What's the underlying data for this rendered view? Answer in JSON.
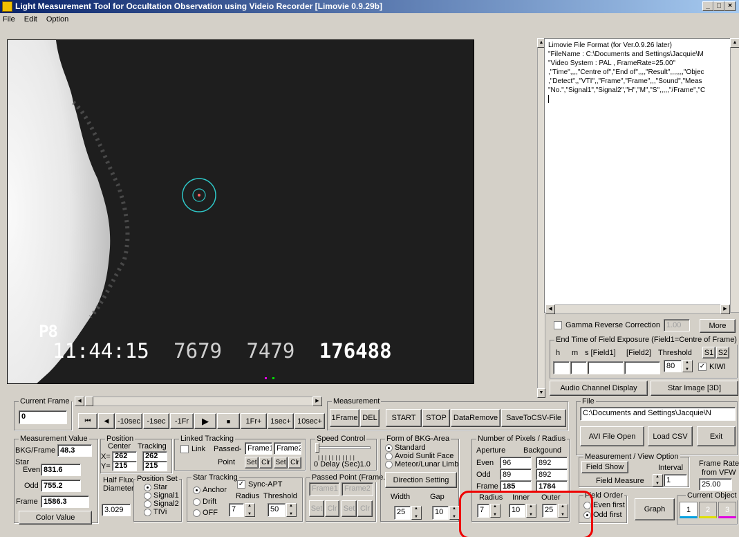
{
  "window": {
    "title": "Light Measurement Tool for Occultation Observation using Videio Recorder [Limovie 0.9.29b]"
  },
  "menu": [
    "File",
    "Edit",
    "Option"
  ],
  "video": {
    "overlay_label": "P8",
    "timestamp": "11:44:15",
    "counter1": "7679",
    "counter2": "7479",
    "counter3": "176488"
  },
  "log": {
    "lines": [
      "Limovie File Format (for Ver.0.9.26 later)",
      "\"FileName : C:\\Documents and Settings\\Jacquie\\M",
      "\"Video System : PAL , FrameRate=25.00\"",
      ",\"Time\",,,,\"Centre of\",\"End of\",,,,\"Result\",,,,,,,\"Objec",
      ",\"Detect\",,\"VTI\",,\"Frame\",\"Frame\",,,\"Sound\",\"Meas",
      "\"No.\",\"Signal1\",\"Signal2\",\"H\",\"M\",\"S\",,,,,\"/Frame\",\"C"
    ]
  },
  "gamma": {
    "label": "Gamma Reverse Correction",
    "value": "1.00",
    "more": "More"
  },
  "field_exposure": {
    "legend": "End Time of Field Exposure (Field1=Centre of Frame)",
    "h": "h",
    "m": "m",
    "s": "s [Field1]",
    "field2": "[Field2]",
    "threshold_label": "Threshold",
    "threshold": "80",
    "s1": "S1",
    "s2": "S2",
    "kiwi": "KIWI"
  },
  "audio_btn": "Audio Channel Display",
  "star_btn": "Star Image [3D]",
  "current_frame": {
    "legend": "Current Frame",
    "value": "0"
  },
  "playback": [
    "⏮",
    "◀",
    "-10sec",
    "-1sec",
    "-1Fr",
    "▶",
    "■",
    "1Fr+",
    "1sec+",
    "10sec+"
  ],
  "measurement": {
    "legend": "Measurement",
    "buttons": [
      "1Frame",
      "DEL",
      "START",
      "STOP",
      "DataRemove",
      "SaveToCSV-File"
    ]
  },
  "file": {
    "legend": "File",
    "path": "C:\\Documents and Settings\\Jacquie\\N",
    "avi": "AVI File Open",
    "csv": "Load CSV",
    "exit": "Exit"
  },
  "mvalue": {
    "legend": "Measurement Value",
    "bkg_label": "BKG/Frame",
    "bkg": "48.3",
    "star": "Star",
    "even_label": "Even",
    "even": "831.6",
    "odd_label": "Odd",
    "odd": "755.2",
    "frame_label": "Frame",
    "frame": "1586.3",
    "color_btn": "Color Value"
  },
  "position": {
    "legend": "Position",
    "center": "Center",
    "tracking": "Tracking",
    "x_label": "X=",
    "y_label": "Y=",
    "cx": "262",
    "cy": "215",
    "tx": "262",
    "ty": "215"
  },
  "linked": {
    "legend": "Linked Tracking",
    "link": "Link",
    "passed": "Passed-",
    "frame1": "Frame1",
    "frame2": "Frame2",
    "point": "Point",
    "set": "Set",
    "clr": "Clr"
  },
  "speed": {
    "legend": "Speed Control",
    "delay": "0  Delay (Sec)1.0"
  },
  "bkg_form": {
    "legend": "Form of BKG-Area",
    "opts": [
      "Standard",
      "Avoid Sunlit Face",
      "Meteor/Lunar Limb"
    ],
    "direction": "Direction Setting",
    "width_label": "Width",
    "gap_label": "Gap",
    "width": "25",
    "gap": "10"
  },
  "pixels": {
    "legend": "Number of Pixels / Radius",
    "aperture": "Aperture",
    "background": "Backgound",
    "even_label": "Even",
    "odd_label": "Odd",
    "frame_label": "Frame",
    "ap_even": "96",
    "ap_odd": "89",
    "ap_frame": "185",
    "bg_even": "892",
    "bg_odd": "892",
    "bg_frame": "1784",
    "radius_label": "Radius",
    "inner_label": "Inner",
    "outer_label": "Outer",
    "radius": "7",
    "inner": "10",
    "outer": "25"
  },
  "half_flux": {
    "label1": "Half Flux",
    "label2": "Diameter",
    "value": "3.029"
  },
  "position_set": {
    "legend": "Position Set",
    "opts": [
      "Star",
      "Signal1",
      "Signal2",
      "TIVi"
    ]
  },
  "star_tracking": {
    "legend": "Star Tracking",
    "sync": "Sync-APT",
    "opts": [
      "Anchor",
      "Drift",
      "OFF"
    ],
    "radius_label": "Radius",
    "threshold_label": "Threshold",
    "radius": "7",
    "threshold": "50"
  },
  "passed_point": {
    "legend": "Passed Point (Frame.)",
    "f1": "Frame1",
    "f2": "Frame2",
    "set": "Set",
    "clr": "Clr"
  },
  "view_option": {
    "legend": "Measurement / View Option",
    "field_show": "Field Show",
    "interval": "Interval",
    "field_measure": "Field Measure",
    "interval_value": "1"
  },
  "frame_rate": {
    "label1": "Frame Rate",
    "label2": "from VFW",
    "value": "25.00"
  },
  "field_order": {
    "legend": "Field Order",
    "even": "Even first",
    "odd": "Odd first"
  },
  "graph": "Graph",
  "current_object": {
    "legend": "Current Object",
    "items": [
      "1",
      "2",
      "3"
    ]
  },
  "colors": {
    "red_highlight": "#e00000",
    "track_ring": "#2ec8c8",
    "obj1": "#00a0e0",
    "obj2": "#e0e000",
    "obj3": "#e000e0"
  }
}
